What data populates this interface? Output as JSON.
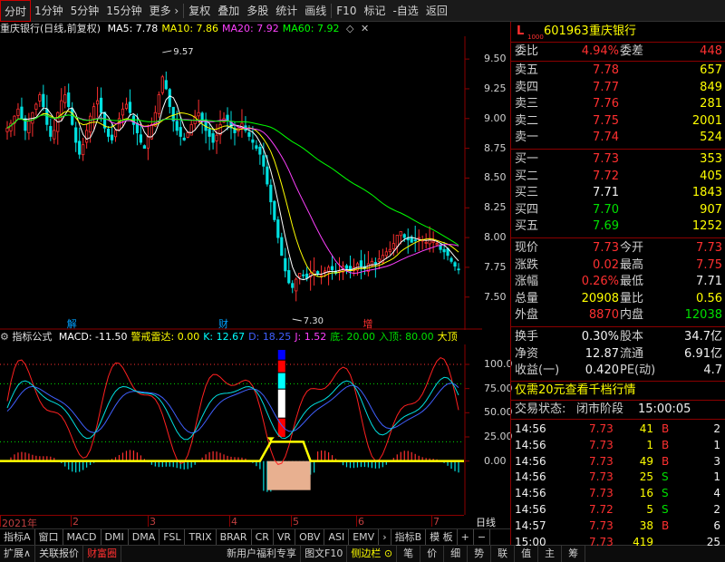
{
  "toolbar": [
    {
      "label": "分时",
      "box": true
    },
    {
      "label": "1分钟"
    },
    {
      "label": "5分钟"
    },
    {
      "label": "15分钟"
    },
    {
      "label": "更多 ›"
    },
    {
      "label": "复权"
    },
    {
      "label": "叠加"
    },
    {
      "label": "多股"
    },
    {
      "label": "统计"
    },
    {
      "label": "画线"
    },
    {
      "label": "F10"
    },
    {
      "label": "标记"
    },
    {
      "label": "-自选"
    },
    {
      "label": "返回"
    }
  ],
  "main_header": {
    "title": "重庆银行(日线,前复权)",
    "ma": [
      {
        "label": "MA5: 7.78",
        "color": "#ffffff"
      },
      {
        "label": "MA10: 7.86",
        "color": "#ffff00"
      },
      {
        "label": "MA20: 7.92",
        "color": "#ff40ff"
      },
      {
        "label": "MA60: 7.92",
        "color": "#00ff00"
      }
    ],
    "icons": [
      "diamond-icon",
      "close-icon"
    ]
  },
  "main_axis": [
    "9.50",
    "9.25",
    "9.00",
    "8.75",
    "8.50",
    "8.25",
    "8.00",
    "7.75",
    "7.50"
  ],
  "annotations": {
    "high": "9.57",
    "low": "7.30",
    "events": [
      "解",
      "财",
      "增"
    ]
  },
  "sub_header": {
    "title": "指标公式",
    "items": [
      {
        "label": "MACD: -11.50",
        "color": "#ffffff"
      },
      {
        "label": "警戒雷达: 0.00",
        "color": "#ffff00"
      },
      {
        "label": "K: 12.67",
        "color": "#00ffff"
      },
      {
        "label": "D: 18.25",
        "color": "#4060ff"
      },
      {
        "label": "J: 1.52",
        "color": "#ff40ff"
      },
      {
        "label": "底: 20.00",
        "color": "#00e000"
      },
      {
        "label": "入顶: 80.00",
        "color": "#00e000"
      },
      {
        "label": "大顶",
        "color": "#ffff00"
      }
    ]
  },
  "sub_axis": [
    "100.0",
    "75.00",
    "50.00",
    "25.00",
    "0.00"
  ],
  "x_axis": [
    "2021年",
    "2",
    "3",
    "4",
    "5",
    "6",
    "7"
  ],
  "x_axis_right": "日线",
  "tabs": [
    "指标A",
    "窗口",
    "MACD",
    "DMI",
    "DMA",
    "FSL",
    "TRIX",
    "BRAR",
    "CR",
    "VR",
    "OBV",
    "ASI",
    "EMV",
    "›",
    "指标B",
    "模 板",
    "+",
    "−"
  ],
  "status_bar": [
    "扩展∧",
    "关联报价",
    "财富圈",
    "新用户福利专享",
    "图文F10",
    "侧边栏 ⊙",
    "笔",
    "价",
    "细",
    "势",
    "联",
    "值",
    "主",
    "筹"
  ],
  "quote": {
    "badge": "L",
    "level": "1000",
    "code": "601963",
    "name": "重庆银行",
    "weibi_label": "委比",
    "weibi": "4.94%",
    "weicha_label": "委差",
    "weicha": "448",
    "sell": [
      {
        "label": "卖五",
        "price": "7.78",
        "vol": "657"
      },
      {
        "label": "卖四",
        "price": "7.77",
        "vol": "849"
      },
      {
        "label": "卖三",
        "price": "7.76",
        "vol": "281"
      },
      {
        "label": "卖二",
        "price": "7.75",
        "vol": "2001"
      },
      {
        "label": "卖一",
        "price": "7.74",
        "vol": "524"
      }
    ],
    "buy": [
      {
        "label": "买一",
        "price": "7.73",
        "vol": "353"
      },
      {
        "label": "买二",
        "price": "7.72",
        "vol": "405"
      },
      {
        "label": "买三",
        "price": "7.71",
        "vol": "1843"
      },
      {
        "label": "买四",
        "price": "7.70",
        "vol": "907"
      },
      {
        "label": "买五",
        "price": "7.69",
        "vol": "1252"
      }
    ],
    "stats": [
      {
        "l1": "现价",
        "v1": "7.73",
        "c1": "red",
        "l2": "今开",
        "v2": "7.73",
        "c2": "red"
      },
      {
        "l1": "涨跌",
        "v1": "0.02",
        "c1": "red",
        "l2": "最高",
        "v2": "7.75",
        "c2": "red"
      },
      {
        "l1": "涨幅",
        "v1": "0.26%",
        "c1": "red",
        "l2": "最低",
        "v2": "7.71",
        "c2": "white"
      },
      {
        "l1": "总量",
        "v1": "20908",
        "c1": "yellow",
        "l2": "量比",
        "v2": "0.56",
        "c2": "yellow"
      },
      {
        "l1": "外盘",
        "v1": "8870",
        "c1": "red",
        "l2": "内盘",
        "v2": "12038",
        "c2": "green"
      }
    ],
    "stats2": [
      {
        "l1": "换手",
        "v1": "0.30%",
        "l2": "股本",
        "v2": "34.7亿"
      },
      {
        "l1": "净资",
        "v1": "12.87",
        "l2": "流通",
        "v2": "6.91亿"
      },
      {
        "l1": "收益(一)",
        "v1": "0.420",
        "l2": "PE(动)",
        "v2": "4.7"
      }
    ],
    "promo": "仅需20元查看千档行情",
    "state_label": "交易状态:",
    "state": "闭市阶段",
    "state_time": "15:00:05",
    "trades": [
      {
        "time": "14:56",
        "price": "7.73",
        "vol": "41",
        "bs": "B",
        "bc": "red",
        "n": "2"
      },
      {
        "time": "14:56",
        "price": "7.73",
        "vol": "1",
        "bs": "B",
        "bc": "red",
        "n": "1"
      },
      {
        "time": "14:56",
        "price": "7.73",
        "vol": "49",
        "bs": "B",
        "bc": "red",
        "n": "3"
      },
      {
        "time": "14:56",
        "price": "7.73",
        "vol": "25",
        "bs": "S",
        "bc": "green",
        "n": "1"
      },
      {
        "time": "14:56",
        "price": "7.73",
        "vol": "16",
        "bs": "S",
        "bc": "green",
        "n": "4"
      },
      {
        "time": "14:56",
        "price": "7.72",
        "vol": "5",
        "bs": "S",
        "bc": "green",
        "n": "2"
      },
      {
        "time": "14:57",
        "price": "7.73",
        "vol": "38",
        "bs": "B",
        "bc": "red",
        "n": "6"
      },
      {
        "time": "15:00",
        "price": "7.73",
        "vol": "419",
        "bs": "",
        "bc": "red",
        "n": "25"
      }
    ]
  },
  "chart_data": {
    "type": "candlestick",
    "x": [
      "2021年",
      "2",
      "3",
      "4",
      "5",
      "6",
      "7"
    ],
    "ylim": [
      7.3,
      9.6
    ],
    "ytick_labels": [
      "9.50",
      "9.25",
      "9.00",
      "8.75",
      "8.50",
      "8.25",
      "8.00",
      "7.75",
      "7.50"
    ],
    "annotations": {
      "high": 9.57,
      "low": 7.3
    },
    "latest": {
      "MA5": 7.78,
      "MA10": 7.86,
      "MA20": 7.92,
      "MA60": 7.92
    },
    "ma_colors": {
      "MA5": "#ffffff",
      "MA10": "#ffff00",
      "MA20": "#ff40ff",
      "MA60": "#00ff00"
    },
    "closes": [
      8.92,
      8.96,
      9.02,
      9.08,
      9.0,
      8.9,
      8.98,
      9.05,
      9.12,
      9.2,
      9.1,
      8.95,
      8.85,
      8.9,
      9.05,
      9.15,
      9.2,
      9.1,
      8.95,
      8.8,
      8.7,
      8.78,
      8.9,
      9.02,
      9.1,
      9.15,
      9.05,
      8.92,
      8.85,
      8.82,
      8.9,
      9.0,
      9.08,
      9.12,
      9.05,
      8.95,
      8.88,
      8.8,
      8.75,
      8.85,
      8.95,
      9.05,
      9.2,
      9.35,
      9.25,
      9.1,
      8.98,
      8.9,
      8.85,
      8.82,
      8.88,
      8.95,
      9.02,
      9.05,
      8.98,
      8.9,
      8.85,
      8.8,
      8.86,
      8.95,
      9.0,
      8.98,
      8.92,
      8.88,
      8.92,
      8.96,
      8.9,
      8.85,
      8.8,
      8.75,
      8.7,
      8.6,
      8.45,
      8.3,
      8.15,
      8.0,
      7.85,
      7.72,
      7.62,
      7.58,
      7.65,
      7.7,
      7.68,
      7.66,
      7.7,
      7.72,
      7.7,
      7.68,
      7.72,
      7.75,
      7.73,
      7.7,
      7.72,
      7.76,
      7.74,
      7.72,
      7.75,
      7.78,
      7.76,
      7.74,
      7.78,
      7.8,
      7.78,
      7.82,
      7.85,
      7.88,
      7.9,
      7.95,
      8.02,
      8.05,
      8.0,
      7.98,
      7.96,
      7.98,
      8.0,
      7.98,
      7.96,
      7.98,
      7.97,
      7.95,
      7.9,
      7.88,
      7.85,
      7.8,
      7.76,
      7.73
    ],
    "sub_chart": {
      "ytick_labels": [
        "100.0",
        "75.00",
        "50.00",
        "25.00",
        "0.00"
      ],
      "ylim": [
        -50,
        115
      ],
      "latest": {
        "MACD": -11.5,
        "警戒雷达": 0,
        "K": 12.67,
        "D": 18.25,
        "J": 1.52,
        "底": 20,
        "入顶": 80
      }
    }
  }
}
